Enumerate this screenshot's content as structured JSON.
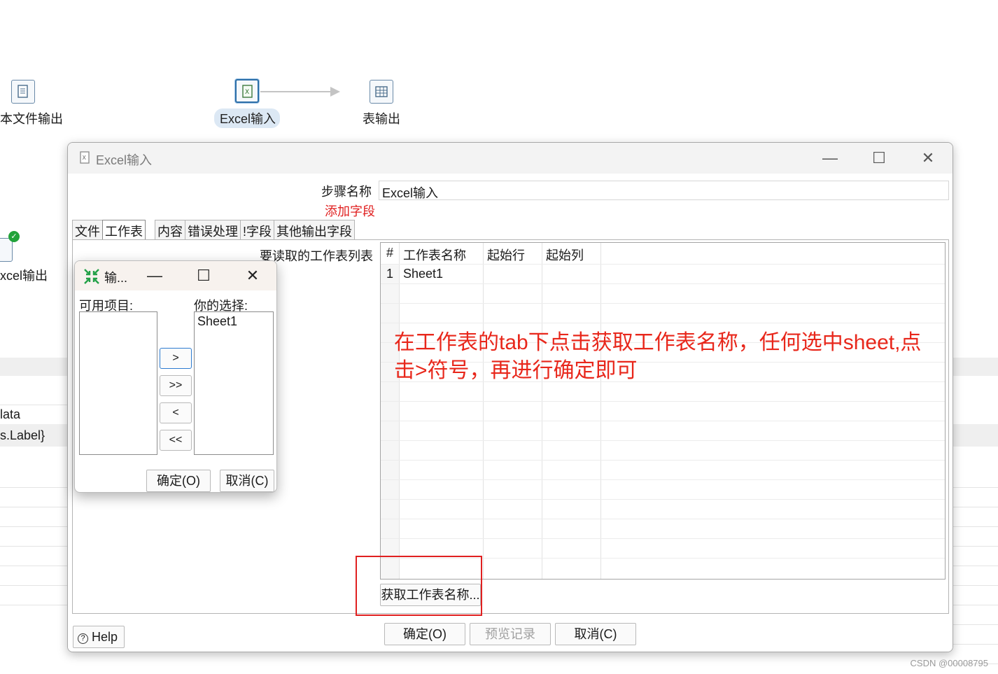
{
  "canvas": {
    "nodes": [
      {
        "label": "本文件输出",
        "icon": "text-file-output-icon"
      },
      {
        "label": "Excel输入",
        "icon": "excel-input-icon"
      },
      {
        "label": "表输出",
        "icon": "table-output-icon"
      },
      {
        "label": "xcel输出",
        "icon": "excel-output-icon"
      }
    ],
    "bg_texts": [
      "lata",
      "s.Label}"
    ]
  },
  "dialog": {
    "title": "Excel输入",
    "minimize": "—",
    "maximize": "☐",
    "close": "✕",
    "step_name_label": "步骤名称",
    "step_name_value": "Excel输入",
    "add_field_label": "添加字段",
    "tabs": [
      "文件",
      "工作表",
      "内容",
      "错误处理",
      "!字段",
      "其他输出字段"
    ],
    "active_tab": "工作表",
    "sheet_list_label": "要读取的工作表列表",
    "grid": {
      "headers": [
        "#",
        "工作表名称",
        "起始行",
        "起始列"
      ],
      "rows": [
        [
          "1",
          "Sheet1",
          "",
          ""
        ]
      ]
    },
    "get_sheet_names_button": "获取工作表名称...",
    "help_button": "Help",
    "ok_button": "确定(O)",
    "preview_button": "预览记录",
    "cancel_button": "取消(C)"
  },
  "annotation": {
    "text": "在工作表的tab下点击获取工作表名称，任何选中sheet,点击>符号，再进行确定即可",
    "color": "#e8271b"
  },
  "select_dialog": {
    "title": "输...",
    "minimize": "—",
    "maximize": "☐",
    "close": "✕",
    "available_label": "可用项目:",
    "selected_label": "你的选择:",
    "selected_items": [
      "Sheet1"
    ],
    "add_one": ">",
    "add_all": ">>",
    "remove_one": "<",
    "remove_all": "<<",
    "ok_button": "确定(O)",
    "cancel_button": "取消(C)"
  },
  "watermark": "CSDN @00008795"
}
